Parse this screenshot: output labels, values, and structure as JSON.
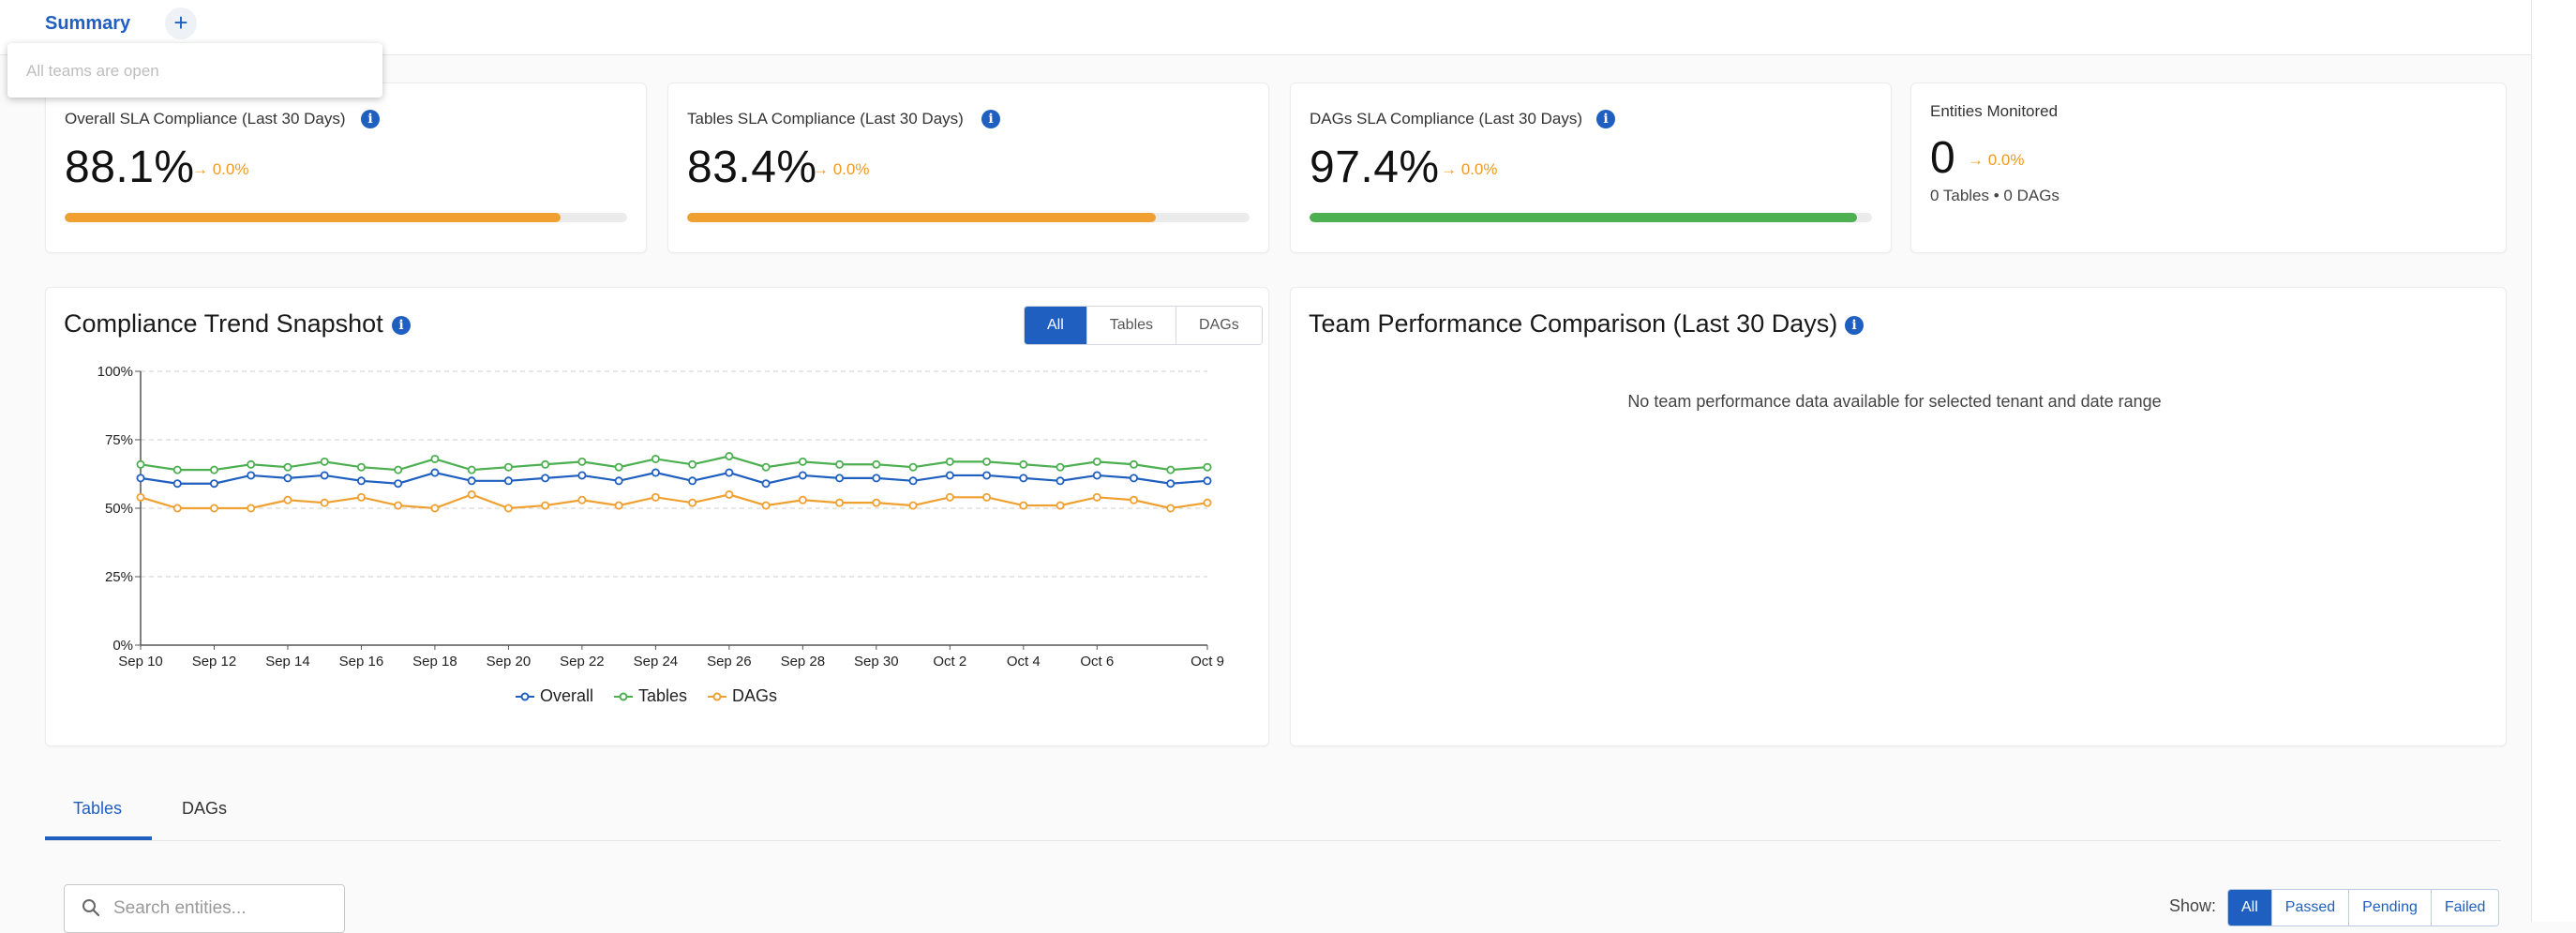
{
  "header": {
    "summary_tab": "Summary",
    "add_tab_icon": "plus-icon"
  },
  "popover": {
    "text": "All teams are open"
  },
  "kpis": [
    {
      "title": "Overall SLA Compliance (Last 30 Days)",
      "value": "88.1%",
      "trend": "→ 0.0%",
      "progress": 88.1,
      "color": "#f0a030"
    },
    {
      "title": "Tables SLA Compliance (Last 30 Days)",
      "value": "83.4%",
      "trend": "→ 0.0%",
      "progress": 83.4,
      "color": "#f0a030"
    },
    {
      "title": "DAGs SLA Compliance (Last 30 Days)",
      "value": "97.4%",
      "trend": "→ 0.0%",
      "progress": 97.4,
      "color": "#4caf50"
    },
    {
      "title": "Entities Monitored",
      "value": "0",
      "trend": "→ 0.0%",
      "sub": "0 Tables • 0 DAGs"
    }
  ],
  "trend": {
    "title": "Compliance Trend Snapshot",
    "segments": [
      "All",
      "Tables",
      "DAGs"
    ],
    "active_segment": "All"
  },
  "team": {
    "title": "Team Performance Comparison (Last 30 Days)",
    "empty_message": "No team performance data available for selected tenant and date range"
  },
  "bottom": {
    "tabs": [
      "Tables",
      "DAGs"
    ],
    "active_tab": "Tables",
    "search_placeholder": "Search entities...",
    "show_label": "Show:",
    "filters": [
      "All",
      "Passed",
      "Pending",
      "Failed"
    ],
    "active_filter": "All"
  },
  "colors": {
    "accent": "#1f5fbf",
    "overall": "#1f5fbf",
    "tables": "#4caf50",
    "dags": "#f0a030"
  },
  "chart_data": {
    "type": "line",
    "x_labels": [
      "Sep 10",
      "Sep 12",
      "Sep 14",
      "Sep 16",
      "Sep 18",
      "Sep 20",
      "Sep 22",
      "Sep 24",
      "Sep 26",
      "Sep 28",
      "Sep 30",
      "Oct 2",
      "Oct 4",
      "Oct 6",
      "Oct 9"
    ],
    "x": [
      "Sep 10",
      "Sep 11",
      "Sep 12",
      "Sep 13",
      "Sep 14",
      "Sep 15",
      "Sep 16",
      "Sep 17",
      "Sep 18",
      "Sep 19",
      "Sep 20",
      "Sep 21",
      "Sep 22",
      "Sep 23",
      "Sep 24",
      "Sep 25",
      "Sep 26",
      "Sep 27",
      "Sep 28",
      "Sep 29",
      "Sep 30",
      "Oct 1",
      "Oct 2",
      "Oct 3",
      "Oct 4",
      "Oct 5",
      "Oct 6",
      "Oct 7",
      "Oct 8",
      "Oct 9"
    ],
    "y_ticks": [
      "0%",
      "25%",
      "50%",
      "75%",
      "100%"
    ],
    "ylim": [
      0,
      100
    ],
    "grid": true,
    "legend": "bottom",
    "series": [
      {
        "name": "Overall",
        "color": "#1f5fbf",
        "values": [
          61,
          59,
          59,
          62,
          61,
          62,
          60,
          59,
          63,
          60,
          60,
          61,
          62,
          60,
          63,
          60,
          63,
          59,
          62,
          61,
          61,
          60,
          62,
          62,
          61,
          60,
          62,
          61,
          59,
          60
        ]
      },
      {
        "name": "Tables",
        "color": "#4caf50",
        "values": [
          66,
          64,
          64,
          66,
          65,
          67,
          65,
          64,
          68,
          64,
          65,
          66,
          67,
          65,
          68,
          66,
          69,
          65,
          67,
          66,
          66,
          65,
          67,
          67,
          66,
          65,
          67,
          66,
          64,
          65
        ]
      },
      {
        "name": "DAGs",
        "color": "#f0a030",
        "values": [
          54,
          50,
          50,
          50,
          53,
          52,
          54,
          51,
          50,
          55,
          50,
          51,
          53,
          51,
          54,
          52,
          55,
          51,
          53,
          52,
          52,
          51,
          54,
          54,
          51,
          51,
          54,
          53,
          50,
          52
        ]
      }
    ]
  }
}
